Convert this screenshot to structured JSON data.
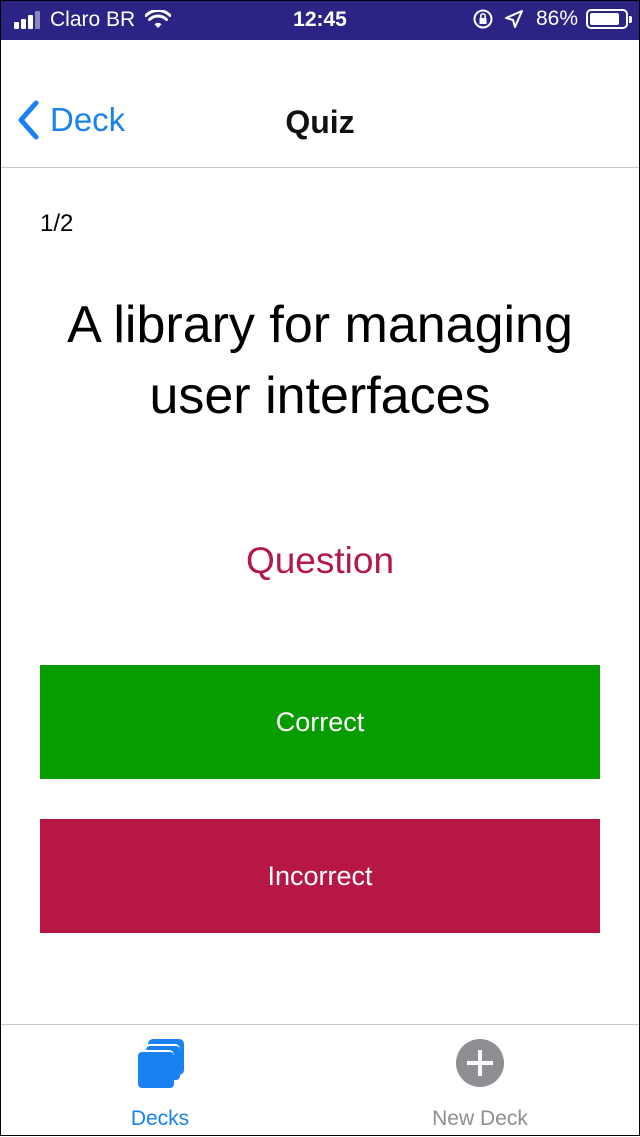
{
  "status_bar": {
    "carrier": "Claro BR",
    "time": "12:45",
    "battery_percent_label": "86%",
    "battery_level": 0.86,
    "signal_bars_filled": 3,
    "signal_bars_total": 4
  },
  "nav": {
    "back_label": "Deck",
    "title": "Quiz"
  },
  "quiz": {
    "counter": "1/2",
    "card_text": "A library for managing user interfaces",
    "toggle_label": "Question"
  },
  "buttons": {
    "correct_label": "Correct",
    "incorrect_label": "Incorrect"
  },
  "tabs": [
    {
      "label": "Decks",
      "icon": "stacked-cards-icon",
      "active": true
    },
    {
      "label": "New Deck",
      "icon": "plus-circle-icon",
      "active": false
    }
  ],
  "colors": {
    "status_bar_bg": "#2b2484",
    "accent_blue": "#1a82f0",
    "toggle_text": "#b3184a",
    "correct_bg": "#079d00",
    "incorrect_bg": "#b71744",
    "tab_inactive": "#8e8e93"
  }
}
